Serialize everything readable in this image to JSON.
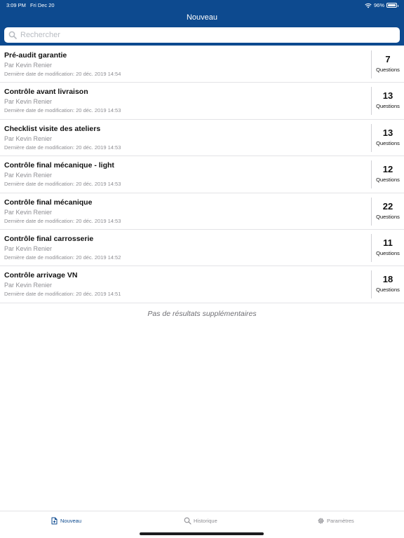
{
  "status_bar": {
    "time": "3:09 PM",
    "date": "Fri Dec 20",
    "battery": "96%"
  },
  "header": {
    "title": "Nouveau"
  },
  "search": {
    "placeholder": "Rechercher",
    "value": ""
  },
  "list": {
    "items": [
      {
        "title": "Pré-audit garantie",
        "author": "Par Kevin Renier",
        "modified": "Dernière date de modification: 20 déc. 2019 14:54",
        "count": "7",
        "count_label": "Questions"
      },
      {
        "title": "Contrôle avant livraison",
        "author": "Par Kevin Renier",
        "modified": "Dernière date de modification: 20 déc. 2019 14:53",
        "count": "13",
        "count_label": "Questions"
      },
      {
        "title": "Checklist visite des ateliers",
        "author": "Par Kevin Renier",
        "modified": "Dernière date de modification: 20 déc. 2019 14:53",
        "count": "13",
        "count_label": "Questions"
      },
      {
        "title": "Contrôle final mécanique - light",
        "author": "Par Kevin Renier",
        "modified": "Dernière date de modification: 20 déc. 2019 14:53",
        "count": "12",
        "count_label": "Questions"
      },
      {
        "title": "Contrôle final mécanique",
        "author": "Par Kevin Renier",
        "modified": "Dernière date de modification: 20 déc. 2019 14:53",
        "count": "22",
        "count_label": "Questions"
      },
      {
        "title": "Contrôle final carrosserie",
        "author": "Par Kevin Renier",
        "modified": "Dernière date de modification: 20 déc. 2019 14:52",
        "count": "11",
        "count_label": "Questions"
      },
      {
        "title": "Contrôle arrivage VN",
        "author": "Par Kevin Renier",
        "modified": "Dernière date de modification: 20 déc. 2019 14:51",
        "count": "18",
        "count_label": "Questions"
      }
    ],
    "footer": "Pas de résultats supplémentaires"
  },
  "tabbar": {
    "tabs": [
      {
        "label": "Nouveau",
        "icon": "new-document-icon",
        "active": true
      },
      {
        "label": "Historique",
        "icon": "search-icon",
        "active": false
      },
      {
        "label": "Paramètres",
        "icon": "gear-icon",
        "active": false
      }
    ]
  },
  "colors": {
    "header_bg": "#0d4a8f",
    "active_tab": "#0d4a8f",
    "inactive_tab": "#8e8e93"
  }
}
